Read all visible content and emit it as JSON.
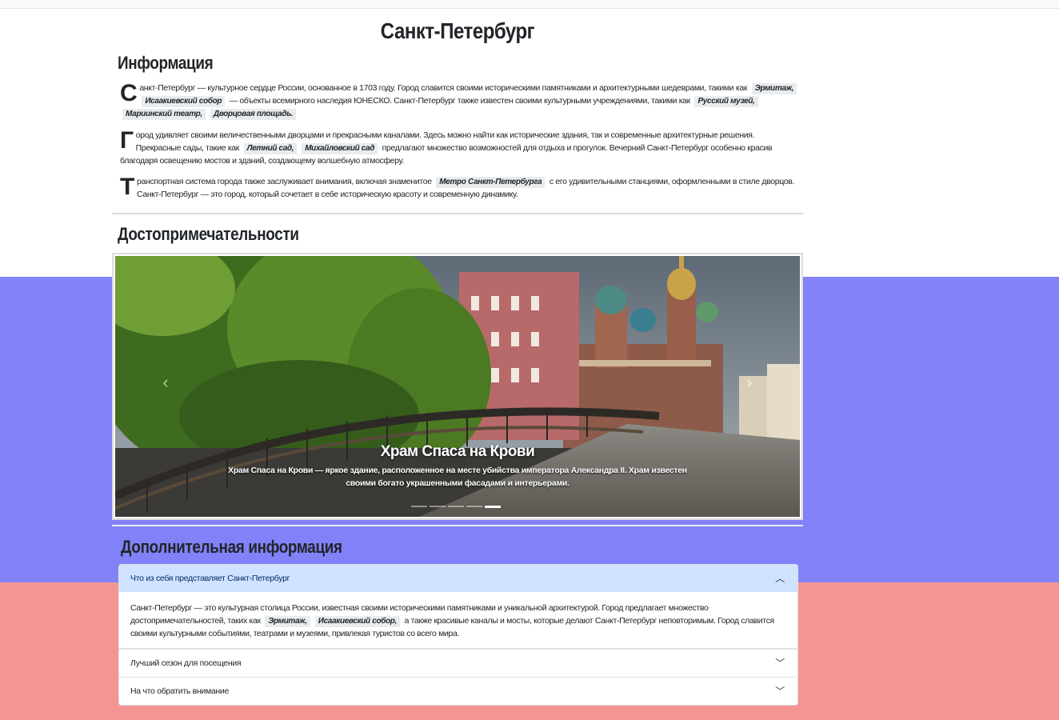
{
  "page": {
    "title": "Санкт-Петербург"
  },
  "info": {
    "heading": "Информация",
    "p1": {
      "cap": "С",
      "text1": "анкт-Петербург — культурное сердце России, основанное в 1703 году. Город славится своими историческими памятниками и архитектурными шедеврами, такими как",
      "tags1": [
        "Эрмитаж,",
        "Исаакиевский собор"
      ],
      "text2": "— объекты всемирного наследия ЮНЕСКО. Санкт-Петербург также известен своими культурными учреждениями, такими как",
      "tags2": [
        "Русский музей,",
        "Мариинский театр,",
        "Дворцовая площадь."
      ]
    },
    "p2": {
      "cap": "Г",
      "text1": "ород удивляет своими величественными дворцами и прекрасными каналами. Здесь можно найти как исторические здания, так и современные архитектурные решения. Прекрасные сады, такие как",
      "tags1": [
        "Летний сад,",
        "Михайловский сад"
      ],
      "text2": "предлагают множество возможностей для отдыха и прогулок. Вечерний Санкт-Петербург особенно красив благодаря освещению мостов и зданий, создающему волшебную атмосферу."
    },
    "p3": {
      "cap": "Т",
      "text1": "ранспортная система города также заслуживает внимания, включая знаменитое",
      "tags1": [
        "Метро Санкт-Петербурга"
      ],
      "text2": "с его удивительными станциями, оформленными в стиле дворцов. Санкт-Петербург — это город, который сочетает в себе историческую красоту и современную динамику."
    }
  },
  "sights": {
    "heading": "Достопримечательности",
    "slide_title": "Храм Спаса на Крови",
    "slide_text": "Храм Спаса на Крови — яркое здание, расположенное на месте убийства императора Александра II. Храм известен своими богато украшенными фасадами и интерьерами.",
    "prev_icon": "chevron-left-icon",
    "next_icon": "chevron-right-icon",
    "slide_count": 5,
    "active_slide": 5
  },
  "extra": {
    "heading": "Дополнительная информация",
    "items": [
      {
        "label": "Что из себя представляет Санкт-Петербург",
        "open": true,
        "body_text1": "Санкт-Петербург — это культурная столица России, известная своими историческими памятниками и уникальной архитектурой. Город предлагает множество достопримечательностей, таких как",
        "body_tags": [
          "Эрмитаж,",
          "Исаакиевский собор,"
        ],
        "body_text2": "а также красивые каналы и мосты, которые делают Санкт-Петербург неповторимым. Город славится своими культурными событиями, театрами и музеями, привлекая туристов со всего мира."
      },
      {
        "label": "Лучший сезон для посещения",
        "open": false
      },
      {
        "label": "На что обратить внимание",
        "open": false
      }
    ]
  },
  "colors": {
    "band_blue": "#8282f8",
    "band_red": "#f49593",
    "accordion_active": "#cfe2ff"
  }
}
